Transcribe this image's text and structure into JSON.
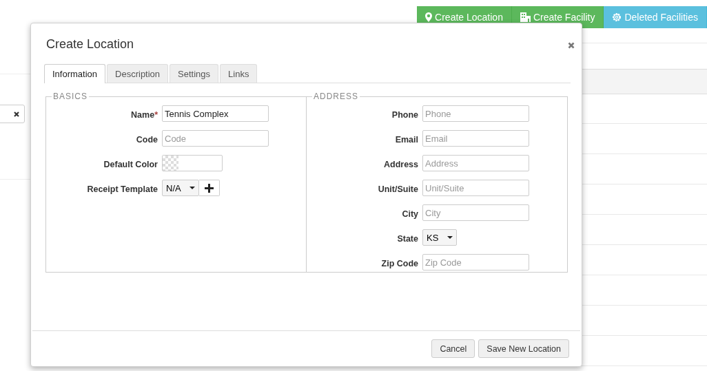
{
  "toolbar": {
    "buttons": [
      {
        "label": "Create Location",
        "kind": "location"
      },
      {
        "label": "Create Facility",
        "kind": "facility"
      },
      {
        "label": "Deleted Facilities",
        "kind": "deleted"
      }
    ]
  },
  "dialog": {
    "title": "Create Location",
    "tabs": [
      {
        "label": "Information",
        "selected": true
      },
      {
        "label": "Description",
        "selected": false
      },
      {
        "label": "Settings",
        "selected": false
      },
      {
        "label": "Links",
        "selected": false
      }
    ],
    "sections": [
      {
        "legend": "BASICS",
        "fields": [
          {
            "label": "Name",
            "required_mark": "*",
            "kind": "text",
            "value": "Tennis Complex"
          },
          {
            "label": "Code",
            "kind": "text",
            "placeholder": "Code"
          },
          {
            "label": "Default Color",
            "kind": "color"
          },
          {
            "label": "Receipt Template",
            "kind": "select-add",
            "value": "N/A"
          }
        ]
      },
      {
        "legend": "ADDRESS",
        "fields": [
          {
            "label": "Phone",
            "kind": "text",
            "placeholder": "Phone"
          },
          {
            "label": "Email",
            "kind": "text",
            "placeholder": "Email"
          },
          {
            "label": "Address",
            "kind": "text",
            "placeholder": "Address"
          },
          {
            "label": "Unit/Suite",
            "kind": "text",
            "placeholder": "Unit/Suite"
          },
          {
            "label": "City",
            "kind": "text",
            "placeholder": "City"
          },
          {
            "label": "State",
            "kind": "select",
            "value": "KS"
          },
          {
            "label": "Zip Code",
            "kind": "text",
            "placeholder": "Zip Code"
          }
        ]
      }
    ],
    "buttons": [
      "Cancel",
      "Save New Location"
    ]
  }
}
